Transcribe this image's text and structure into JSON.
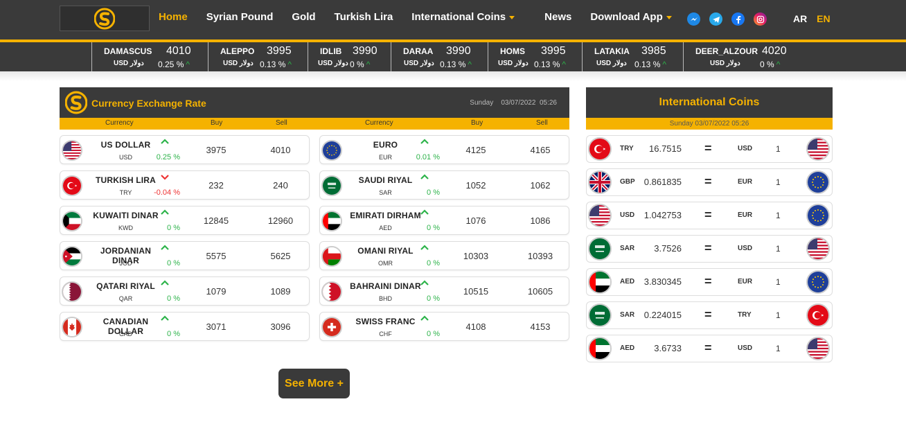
{
  "nav": {
    "home": "Home",
    "syrian_pound": "Syrian Pound",
    "gold": "Gold",
    "turkish_lira": "Turkish Lira",
    "international_coins": "International Coins",
    "news": "News",
    "download_app": "Download App"
  },
  "lang": {
    "ar": "AR",
    "en": "EN"
  },
  "ticker": [
    {
      "city": "DAMASCUS",
      "price": "4010",
      "currency": "USD دولار",
      "change": "0.25 %"
    },
    {
      "city": "ALEPPO",
      "price": "3995",
      "currency": "USD دولار",
      "change": "0.13 %"
    },
    {
      "city": "IDLIB",
      "price": "3990",
      "currency": "USD دولار",
      "change": "0 %"
    },
    {
      "city": "DARAA",
      "price": "3990",
      "currency": "USD دولار",
      "change": "0.13 %"
    },
    {
      "city": "HOMS",
      "price": "3995",
      "currency": "USD دولار",
      "change": "0.13 %"
    },
    {
      "city": "LATAKIA",
      "price": "3985",
      "currency": "USD دولار",
      "change": "0.13 %"
    },
    {
      "city": "DEER_ALZOUR",
      "price": "4020",
      "currency": "USD دولار",
      "change": "0 %"
    }
  ],
  "exchange": {
    "title": "Currency Exchange Rate",
    "day": "Sunday",
    "date": "03/07/2022",
    "time": "05:26",
    "col_currency": "Currency",
    "col_buy": "Buy",
    "col_sell": "Sell",
    "rows": [
      {
        "name": "US DOLLAR",
        "code": "USD",
        "pct": "0.25 %",
        "buy": "3975",
        "sell": "4010",
        "dir": "up"
      },
      {
        "name": "EURO",
        "code": "EUR",
        "pct": "0.01 %",
        "buy": "4125",
        "sell": "4165",
        "dir": "up"
      },
      {
        "name": "TURKISH LIRA",
        "code": "TRY",
        "pct": "-0.04 %",
        "buy": "232",
        "sell": "240",
        "dir": "down"
      },
      {
        "name": "SAUDI RIYAL",
        "code": "SAR",
        "pct": "0 %",
        "buy": "1052",
        "sell": "1062",
        "dir": "up"
      },
      {
        "name": "KUWAITI DINAR",
        "code": "KWD",
        "pct": "0 %",
        "buy": "12845",
        "sell": "12960",
        "dir": "up"
      },
      {
        "name": "EMIRATI DIRHAM",
        "code": "AED",
        "pct": "0 %",
        "buy": "1076",
        "sell": "1086",
        "dir": "up"
      },
      {
        "name": "JORDANIAN DINAR",
        "code": "JOD",
        "pct": "0 %",
        "buy": "5575",
        "sell": "5625",
        "dir": "up"
      },
      {
        "name": "OMANI RIYAL",
        "code": "OMR",
        "pct": "0 %",
        "buy": "10303",
        "sell": "10393",
        "dir": "up"
      },
      {
        "name": "QATARI RIYAL",
        "code": "QAR",
        "pct": "0 %",
        "buy": "1079",
        "sell": "1089",
        "dir": "up"
      },
      {
        "name": "BAHRAINI DINAR",
        "code": "BHD",
        "pct": "0 %",
        "buy": "10515",
        "sell": "10605",
        "dir": "up"
      },
      {
        "name": "CANADIAN DOLLAR",
        "code": "CAD",
        "pct": "0 %",
        "buy": "3071",
        "sell": "3096",
        "dir": "up"
      },
      {
        "name": "SWISS FRANC",
        "code": "CHF",
        "pct": "0 %",
        "buy": "4108",
        "sell": "4153",
        "dir": "up"
      }
    ],
    "see_more": "See More +"
  },
  "intl": {
    "title": "International Coins",
    "date": "Sunday 03/07/2022 05:26",
    "rows": [
      {
        "from": "TRY",
        "rate": "16.7515",
        "eq": "=",
        "to": "USD",
        "one": "1"
      },
      {
        "from": "GBP",
        "rate": "0.861835",
        "eq": "=",
        "to": "EUR",
        "one": "1"
      },
      {
        "from": "USD",
        "rate": "1.042753",
        "eq": "=",
        "to": "EUR",
        "one": "1"
      },
      {
        "from": "SAR",
        "rate": "3.7526",
        "eq": "=",
        "to": "USD",
        "one": "1"
      },
      {
        "from": "AED",
        "rate": "3.830345",
        "eq": "=",
        "to": "EUR",
        "one": "1"
      },
      {
        "from": "SAR",
        "rate": "0.224015",
        "eq": "=",
        "to": "TRY",
        "one": "1"
      },
      {
        "from": "AED",
        "rate": "3.6733",
        "eq": "=",
        "to": "USD",
        "one": "1"
      }
    ]
  },
  "colors": {
    "accent": "#f5b200",
    "dark": "#3a3a3a",
    "up": "#2db34a",
    "down": "#e33333"
  }
}
